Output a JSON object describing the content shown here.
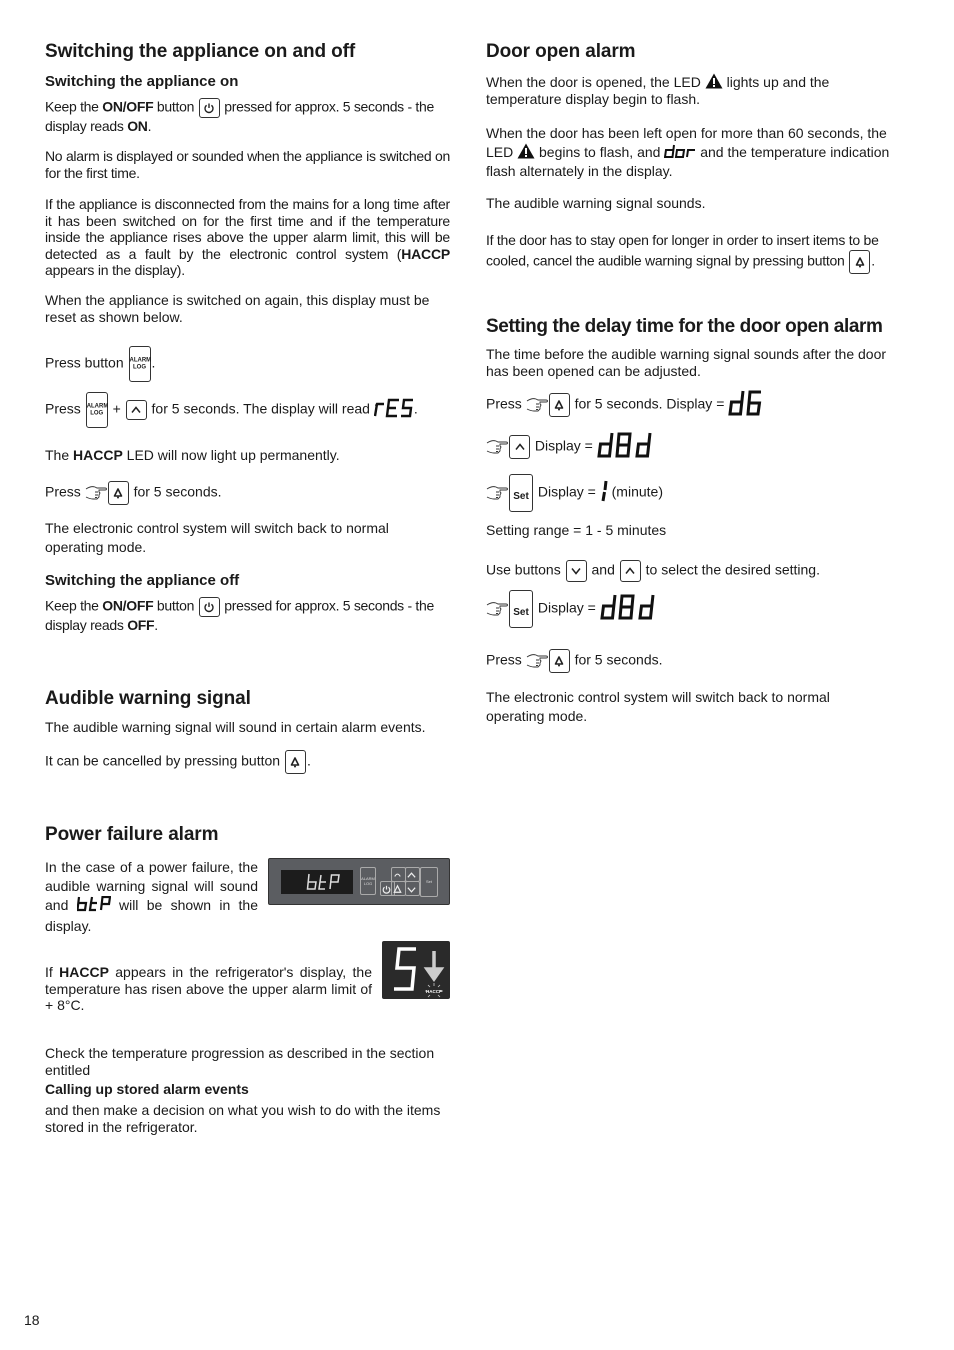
{
  "left": {
    "section_on_off": {
      "title": "Switching the appliance on and off",
      "sub_on": "Switching the appliance on",
      "p1_a": "Keep the ",
      "p1_bold": "ON/OFF",
      "p1_b": " button ",
      "p1_c": " pressed for approx. 5 seconds - the display reads ",
      "p1_bold2": "ON",
      "p1_end": ".",
      "p2": "No alarm is displayed or sounded when the appliance is switched on for the first time.",
      "p3_a": "If the appliance is disconnected from the mains for a long time after it has been switched on for the first time and if the temperature inside the appliance rises above the upper alarm limit, this will be detected as a fault by the electronic control system (",
      "p3_bold": "HACCP",
      "p3_b": " appears in the display).",
      "p4": "When the appliance is switched on again, this display must be reset as shown below.",
      "press_button": "Press button ",
      "period": ".",
      "press": "Press ",
      "plus": " + ",
      "p5_b": " for 5 seconds. The display will read ",
      "res_display": "rES",
      "p6_a": "The ",
      "p6_bold": "HACCP",
      "p6_b": " LED will now light up permanently.",
      "for5": " for 5 seconds.",
      "p7": "The electronic control system will switch back to normal operating mode.",
      "sub_off": "Switching the appliance off",
      "p8_c": " pressed for approx. 5 seconds - the display reads ",
      "p8_bold2": "OFF",
      "alarm_key_line1": "ALARM",
      "alarm_key_line2": "LOG"
    },
    "section_audible": {
      "title": "Audible warning signal",
      "p1": "The audible warning signal will sound in certain alarm events.",
      "p2": "It can be cancelled by pressing button "
    },
    "section_power": {
      "title": "Power failure alarm",
      "p1_a": "In the case of a power failure, the audible warning signal will sound and ",
      "btp": "btP",
      "p1_b": " will be shown in the display.",
      "p2_a": "If ",
      "p2_bold": "HACCP",
      "p2_b": " appears in the refrigerator's display, the temperature has risen above the upper alarm limit of + 8°C.",
      "p3": "Check the temperature progression as described in the section entitled",
      "p3_bold": "Calling up stored alarm events",
      "p4": "and then make a decision on what you wish to do with the items stored in the refrigerator.",
      "panel_display": "btP",
      "panel_alarm_label": "ALARM LOG",
      "panel_set_label": "Set",
      "haccp_digit": "5",
      "haccp_label": "HACCP"
    }
  },
  "right": {
    "section_door": {
      "title": "Door open alarm",
      "p1_a": "When the door is opened, the LED ",
      "p1_b": " lights up and the temperature display begin to flash.",
      "p2_a": "When the door has been left open for more than 60 seconds, the LED ",
      "p2_b": " begins to flash, and ",
      "dor": "dor",
      "p2_c": " and the temperature indication flash alternately in the display.",
      "p3": "The audible warning signal sounds.",
      "p4": "If the door has to stay open for longer in order to insert items to be cooled, cancel the audible warning signal by pressing button "
    },
    "section_delay": {
      "title": "Setting the delay time for the door open alarm",
      "p1": "The time before the audible warning signal sounds after the door has been opened can be adjusted.",
      "press": "Press ",
      "for5_display": " for 5 seconds. Display = ",
      "d6": "d6",
      "display_eq": " Display = ",
      "d8d": "d8d",
      "one": "1",
      "minute": " (minute)",
      "range": "Setting range = 1 - 5 minutes",
      "use_a": "Use buttons ",
      "and": " and ",
      "use_b": " to select the desired setting.",
      "for5": " for 5 seconds.",
      "final": "The electronic control system will switch back to normal operating mode.",
      "set_label": "Set"
    }
  },
  "page_number": "18"
}
